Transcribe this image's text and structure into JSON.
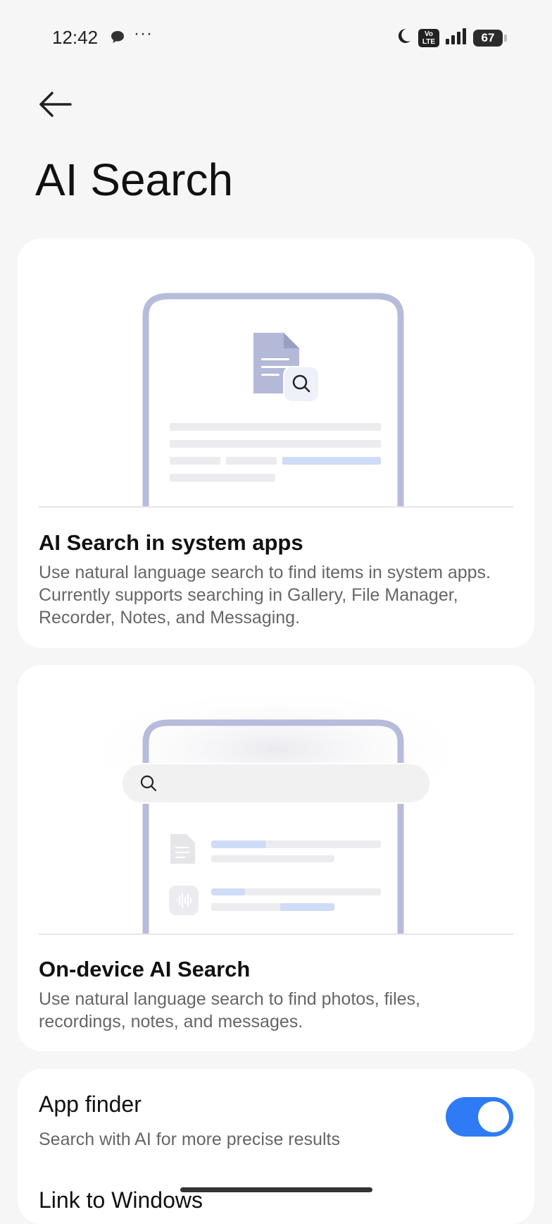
{
  "status_bar": {
    "time": "12:42",
    "dots": "···",
    "volte_top": "Vo",
    "volte_bottom": "LTE",
    "battery": "67"
  },
  "header": {
    "title": "AI Search"
  },
  "cards": [
    {
      "title": "AI Search in system apps",
      "description": "Use natural language search to find items in system apps. Currently supports searching in Gallery, File Manager, Recorder, Notes, and Messaging."
    },
    {
      "title": "On-device AI Search",
      "description": "Use natural language search to find photos, files, recordings, notes, and messages."
    }
  ],
  "settings": {
    "app_finder": {
      "title": "App finder",
      "subtitle": "Search with AI for more precise results",
      "enabled": true
    },
    "link_to_windows": {
      "title": "Link to Windows"
    }
  },
  "colors": {
    "accent": "#2f7bf5",
    "phone_outline": "#b7bcdb",
    "highlight": "#cfdcf7"
  }
}
